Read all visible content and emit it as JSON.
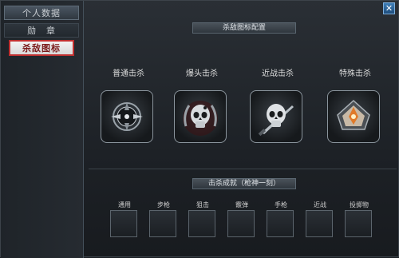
{
  "sidebar": {
    "items": [
      {
        "label": "个人数据"
      },
      {
        "label": "勋　章"
      },
      {
        "label": "杀敌图标"
      }
    ]
  },
  "close": {
    "label": "✕"
  },
  "sections": {
    "kill_icons_title": "杀敌图标配置",
    "achievements_title": "击杀成就（枪神一刻）"
  },
  "kill_types": [
    {
      "label": "普通击杀",
      "icon": "crosshair-emblem-icon"
    },
    {
      "label": "爆头击杀",
      "icon": "skull-laurel-icon"
    },
    {
      "label": "近战击杀",
      "icon": "skull-knife-icon"
    },
    {
      "label": "特殊击杀",
      "icon": "grenade-emblem-icon"
    }
  ],
  "achievements": [
    {
      "label": "通用"
    },
    {
      "label": "步枪"
    },
    {
      "label": "狙击"
    },
    {
      "label": "霰弹"
    },
    {
      "label": "手枪"
    },
    {
      "label": "近战"
    },
    {
      "label": "投掷物"
    }
  ]
}
